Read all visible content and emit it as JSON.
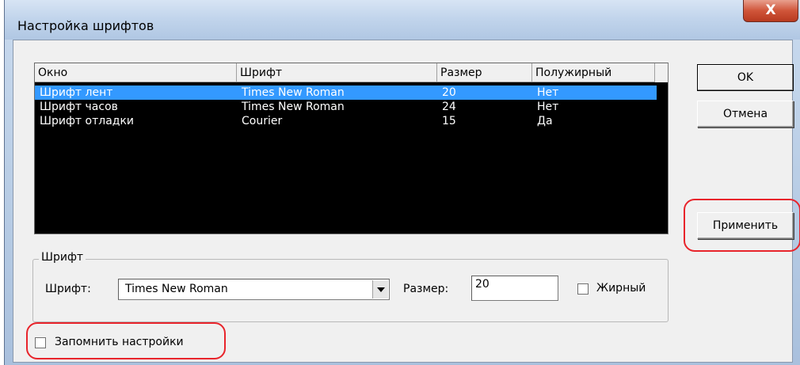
{
  "window": {
    "title": "Настройка шрифтов",
    "close_glyph": "X"
  },
  "listview": {
    "columns": [
      "Окно",
      "Шрифт",
      "Размер",
      "Полужирный"
    ],
    "rows": [
      {
        "window": "Шрифт лент",
        "font": "Times New Roman",
        "size": "20",
        "bold": "Нет",
        "selected": true
      },
      {
        "window": "Шрифт часов",
        "font": "Times New Roman",
        "size": "24",
        "bold": "Нет",
        "selected": false
      },
      {
        "window": "Шрифт отладки",
        "font": "Courier",
        "size": "15",
        "bold": "Да",
        "selected": false
      }
    ]
  },
  "font_group": {
    "label": "Шрифт",
    "font_label": "Шрифт:",
    "font_value": "Times New Roman",
    "size_label": "Размер:",
    "size_value": "20",
    "bold_label": "Жирный",
    "bold_checked": false
  },
  "remember": {
    "label": "Запомнить настройки",
    "checked": false
  },
  "buttons": {
    "ok": "OK",
    "cancel": "Отмена",
    "apply": "Применить"
  },
  "colors": {
    "selection": "#3399ff",
    "highlight_ring": "#e8242b",
    "list_background": "#000000"
  }
}
